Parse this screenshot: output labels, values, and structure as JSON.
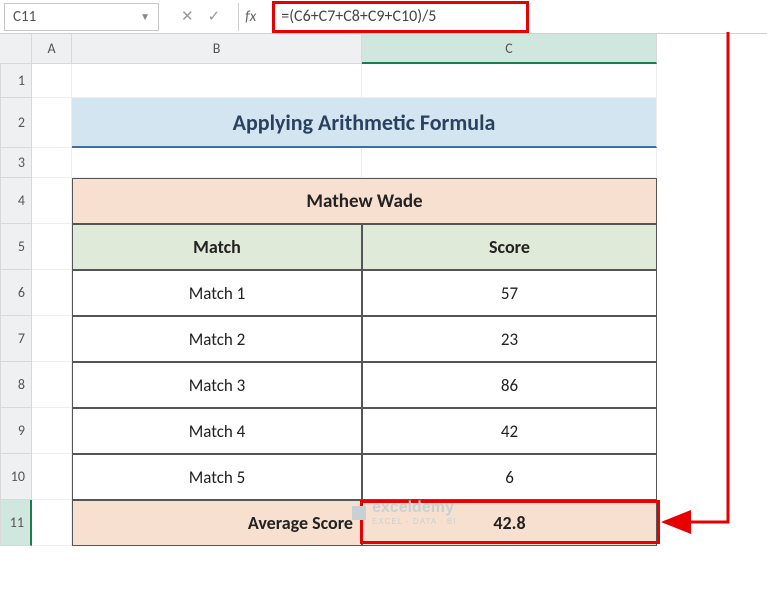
{
  "formula_bar": {
    "cell_reference": "C11",
    "fx_label": "fx",
    "formula": "=(C6+C7+C8+C9+C10)/5"
  },
  "columns": [
    "A",
    "B",
    "C"
  ],
  "rows": [
    "1",
    "2",
    "3",
    "4",
    "5",
    "6",
    "7",
    "8",
    "9",
    "10",
    "11"
  ],
  "title": "Applying Arithmetic Formula",
  "table": {
    "player_name": "Mathew Wade",
    "headers": {
      "match": "Match",
      "score": "Score"
    },
    "rows": [
      {
        "match": "Match 1",
        "score": "57"
      },
      {
        "match": "Match 2",
        "score": "23"
      },
      {
        "match": "Match 3",
        "score": "86"
      },
      {
        "match": "Match 4",
        "score": "42"
      },
      {
        "match": "Match 5",
        "score": "6"
      }
    ],
    "average_label": "Average Score",
    "average_value": "42.8"
  },
  "watermark": {
    "brand": "exceldemy",
    "tagline": "EXCEL · DATA · BI"
  },
  "chart_data": {
    "type": "table",
    "title": "Mathew Wade",
    "columns": [
      "Match",
      "Score"
    ],
    "rows": [
      [
        "Match 1",
        57
      ],
      [
        "Match 2",
        23
      ],
      [
        "Match 3",
        86
      ],
      [
        "Match 4",
        42
      ],
      [
        "Match 5",
        6
      ]
    ],
    "summary": {
      "label": "Average Score",
      "value": 42.8
    }
  }
}
